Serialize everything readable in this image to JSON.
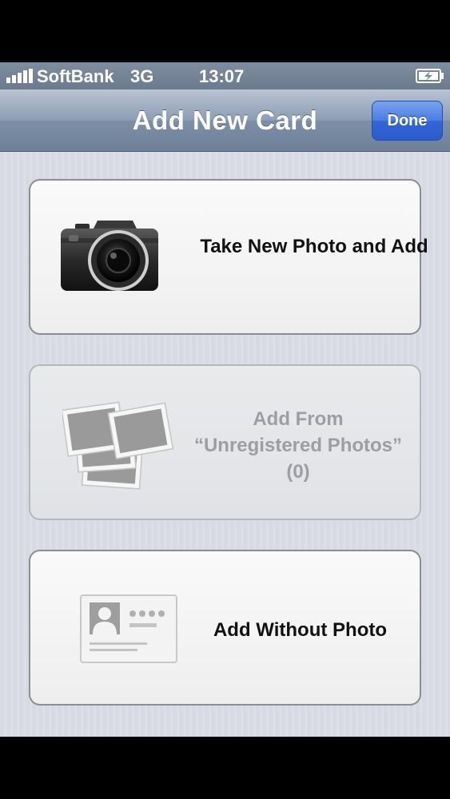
{
  "status_bar": {
    "carrier": "SoftBank",
    "network": "3G",
    "time": "13:07"
  },
  "nav_bar": {
    "title": "Add New Card",
    "done_label": "Done"
  },
  "options": {
    "take_photo": {
      "label": "Take New Photo and Add",
      "icon": "camera-icon",
      "enabled": true
    },
    "from_unregistered": {
      "line1": "Add From",
      "line2": "“Unregistered Photos”",
      "line3": "(0)",
      "icon": "photos-stack-icon",
      "enabled": false
    },
    "without_photo": {
      "label": "Add Without Photo",
      "icon": "id-card-icon",
      "enabled": true
    }
  },
  "colors": {
    "accent_button": "#3466d6",
    "nav_bar": "#7d8fa6",
    "background": "#d9dce4"
  }
}
